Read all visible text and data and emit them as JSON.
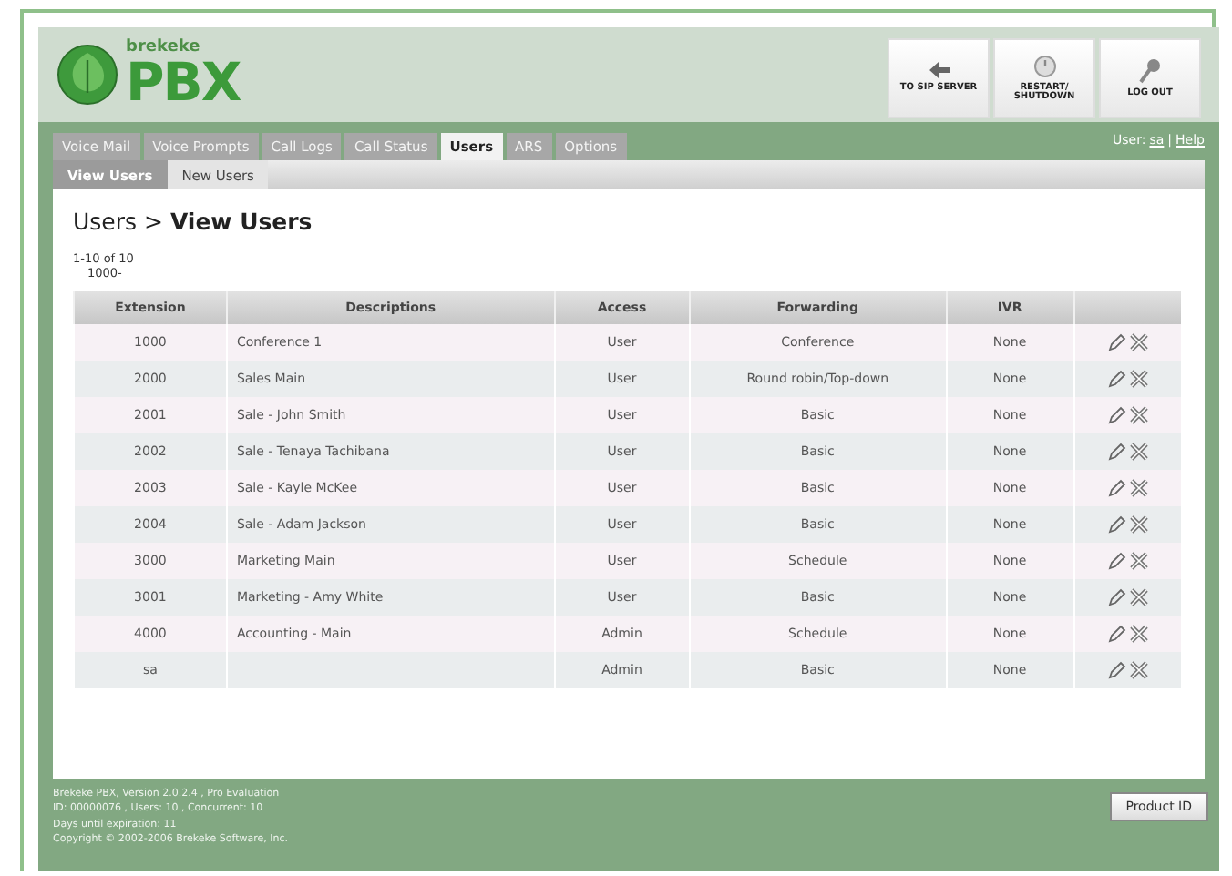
{
  "logo": {
    "brand": "brekeke",
    "product": "PBX"
  },
  "header_buttons": [
    {
      "kind": "arrow",
      "label": "TO SIP SERVER"
    },
    {
      "kind": "power",
      "label": "RESTART/ SHUTDOWN"
    },
    {
      "kind": "key",
      "label": "LOG OUT"
    }
  ],
  "tabs": [
    {
      "label": "Voice Mail",
      "selected": false
    },
    {
      "label": "Voice Prompts",
      "selected": false
    },
    {
      "label": "Call Logs",
      "selected": false
    },
    {
      "label": "Call Status",
      "selected": false
    },
    {
      "label": "Users",
      "selected": true
    },
    {
      "label": "ARS",
      "selected": false
    },
    {
      "label": "Options",
      "selected": false
    }
  ],
  "user_links": {
    "user_label": "User:",
    "user": "sa",
    "separator": "|",
    "help": "Help"
  },
  "subtabs": [
    {
      "label": "View Users",
      "selected": true
    },
    {
      "label": "New Users",
      "selected": false
    }
  ],
  "breadcrumb": {
    "parent": "Users >",
    "current": "View Users"
  },
  "range": "1-10 of 10",
  "filter": "1000-",
  "table": {
    "columns": [
      "Extension",
      "Descriptions",
      "Access",
      "Forwarding",
      "IVR"
    ],
    "rows": [
      [
        "1000",
        "Conference 1",
        "User",
        "Conference",
        "None"
      ],
      [
        "2000",
        "Sales Main",
        "User",
        "Round robin/Top-down",
        "None"
      ],
      [
        "2001",
        "Sale - John Smith",
        "User",
        "Basic",
        "None"
      ],
      [
        "2002",
        "Sale - Tenaya Tachibana",
        "User",
        "Basic",
        "None"
      ],
      [
        "2003",
        "Sale - Kayle McKee",
        "User",
        "Basic",
        "None"
      ],
      [
        "2004",
        "Sale - Adam Jackson",
        "User",
        "Basic",
        "None"
      ],
      [
        "3000",
        "Marketing Main",
        "User",
        "Schedule",
        "None"
      ],
      [
        "3001",
        "Marketing - Amy White",
        "User",
        "Basic",
        "None"
      ],
      [
        "4000",
        "Accounting - Main",
        "Admin",
        "Schedule",
        "None"
      ],
      [
        "sa",
        "",
        "Admin",
        "Basic",
        "None"
      ]
    ]
  },
  "footer": {
    "lines": [
      "Brekeke PBX, Version 2.0.2.4 , Pro Evaluation",
      "ID: 00000076 , Users: 10 , Concurrent: 10",
      "Days until expiration: 11",
      "Copyright © 2002-2006 Brekeke Software, Inc."
    ],
    "button": "Product ID"
  }
}
